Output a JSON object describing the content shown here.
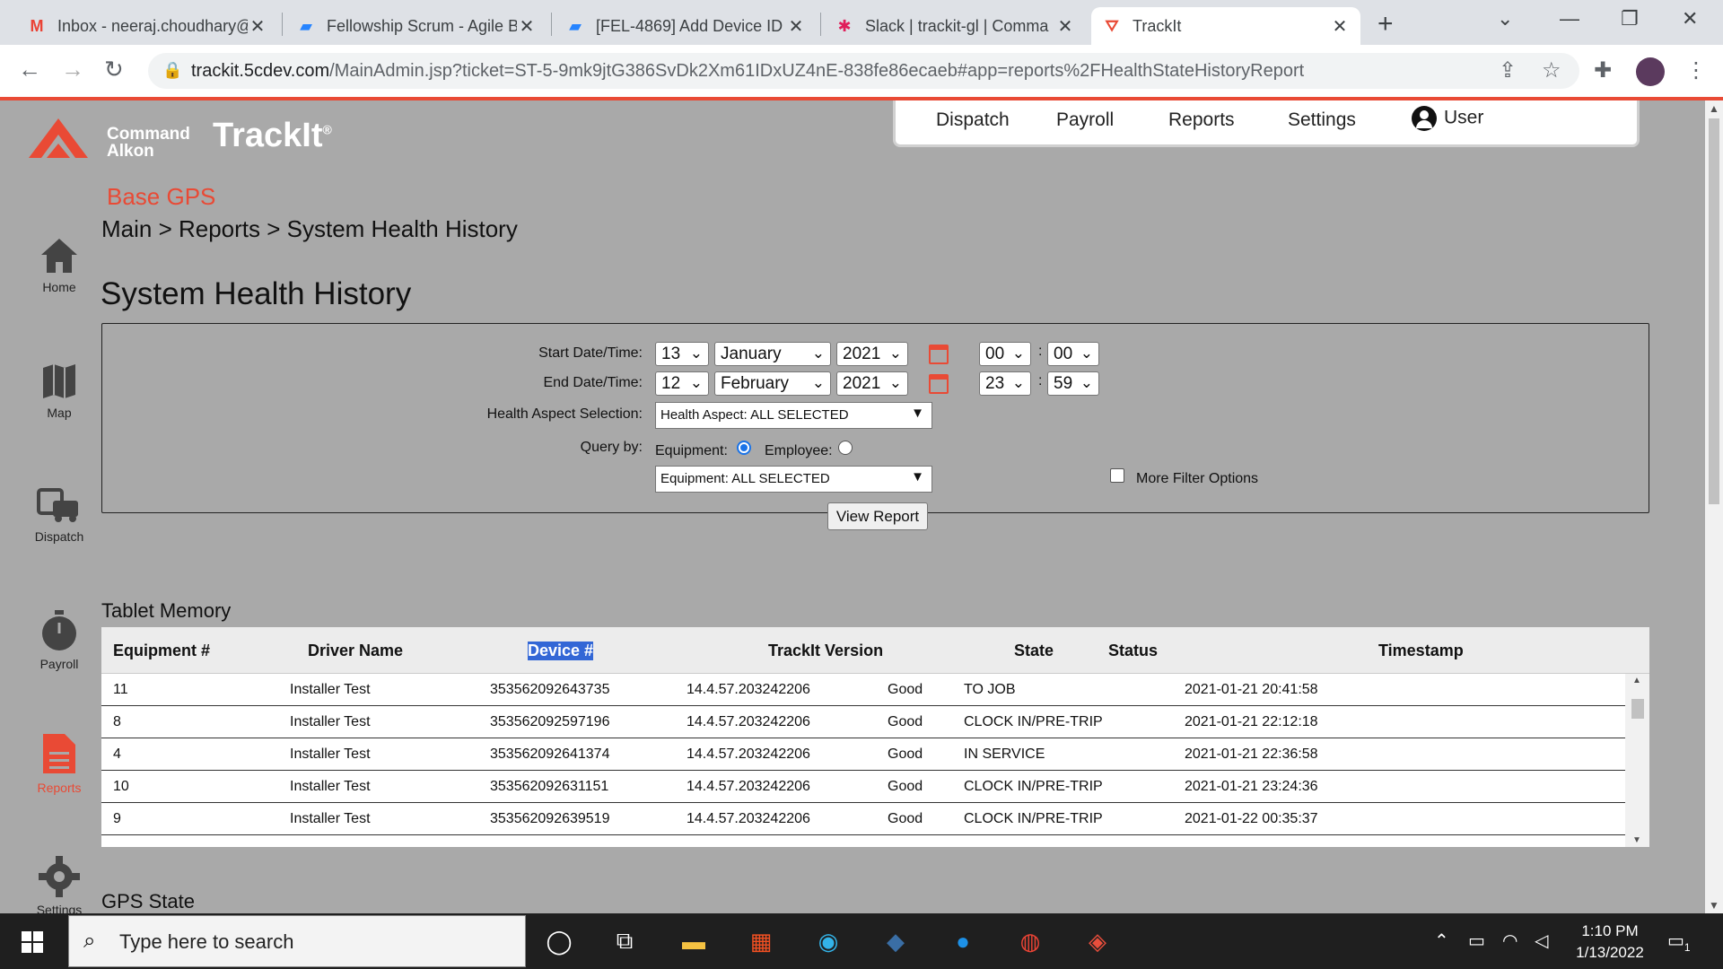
{
  "browser": {
    "tabs": [
      {
        "label": "Inbox - neeraj.choudhary@",
        "icon": "gmail-icon",
        "active": false
      },
      {
        "label": "Fellowship Scrum - Agile B",
        "icon": "jira-icon",
        "active": false
      },
      {
        "label": "[FEL-4869] Add Device ID",
        "icon": "jira-icon",
        "active": false
      },
      {
        "label": "Slack | trackit-gl | Comma",
        "icon": "slack-icon",
        "active": false
      },
      {
        "label": "TrackIt",
        "icon": "trackit-icon",
        "active": true
      }
    ],
    "url_host": "trackit.5cdev.com",
    "url_rest": "/MainAdmin.jsp?ticket=ST-5-9mk9jtG386SvDk2Xm61IDxUZ4nE-838fe86ecaeb#app=reports%2FHealthStateHistoryReport"
  },
  "app": {
    "brand_line1": "Command",
    "brand_line2": "Alkon",
    "product": "TrackIt",
    "product_mark": "®",
    "subtitle": "Base GPS",
    "breadcrumb": "Main > Reports > System Health History",
    "title": "System Health History",
    "brand_color": "#e94a35"
  },
  "topnav": {
    "items": [
      "Dispatch",
      "Payroll",
      "Reports",
      "Settings"
    ],
    "user": "User"
  },
  "sidebar": {
    "items": [
      {
        "label": "Home",
        "icon": "home-icon"
      },
      {
        "label": "Map",
        "icon": "map-icon"
      },
      {
        "label": "Dispatch",
        "icon": "truck-icon"
      },
      {
        "label": "Payroll",
        "icon": "stopwatch-icon"
      },
      {
        "label": "Reports",
        "icon": "document-icon",
        "active": true
      },
      {
        "label": "Settings",
        "icon": "gear-icon"
      }
    ]
  },
  "filter": {
    "start_label": "Start Date/Time:",
    "end_label": "End Date/Time:",
    "start": {
      "day": "13",
      "month": "January",
      "year": "2021",
      "hour": "00",
      "minute": "00"
    },
    "end": {
      "day": "12",
      "month": "February",
      "year": "2021",
      "hour": "23",
      "minute": "59"
    },
    "colon": ":",
    "health_label": "Health Aspect Selection:",
    "health_value": "Health Aspect: ALL SELECTED",
    "query_label": "Query by:",
    "equipment_label": "Equipment:",
    "employee_label": "Employee:",
    "query_selected": "equipment",
    "equipment_value": "Equipment: ALL SELECTED",
    "more_filters": "More Filter Options",
    "view_report": "View Report"
  },
  "tablet_memory": {
    "title": "Tablet Memory",
    "columns": [
      "Equipment #",
      "Driver Name",
      "Device #",
      "TrackIt Version",
      "State",
      "Status",
      "Timestamp"
    ],
    "rows": [
      [
        "11",
        "Installer Test",
        "353562092643735",
        "14.4.57.203242206",
        "Good",
        "TO JOB",
        "2021-01-21 20:41:58"
      ],
      [
        "8",
        "Installer Test",
        "353562092597196",
        "14.4.57.203242206",
        "Good",
        "CLOCK IN/PRE-TRIP",
        "2021-01-21 22:12:18"
      ],
      [
        "4",
        "Installer Test",
        "353562092641374",
        "14.4.57.203242206",
        "Good",
        "IN SERVICE",
        "2021-01-21 22:36:58"
      ],
      [
        "10",
        "Installer Test",
        "353562092631151",
        "14.4.57.203242206",
        "Good",
        "CLOCK IN/PRE-TRIP",
        "2021-01-21 23:24:36"
      ],
      [
        "9",
        "Installer Test",
        "353562092639519",
        "14.4.57.203242206",
        "Good",
        "CLOCK IN/PRE-TRIP",
        "2021-01-22 00:35:37"
      ]
    ]
  },
  "gps_state": {
    "title": "GPS State"
  },
  "taskbar": {
    "search_placeholder": "Type here to search",
    "time": "1:10 PM",
    "date": "1/13/2022",
    "notifications": "1"
  }
}
